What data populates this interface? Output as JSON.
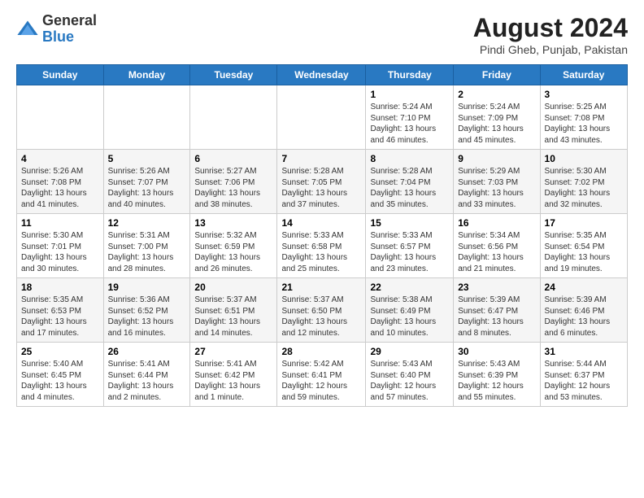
{
  "header": {
    "logo_general": "General",
    "logo_blue": "Blue",
    "month_year": "August 2024",
    "location": "Pindi Gheb, Punjab, Pakistan"
  },
  "weekdays": [
    "Sunday",
    "Monday",
    "Tuesday",
    "Wednesday",
    "Thursday",
    "Friday",
    "Saturday"
  ],
  "weeks": [
    [
      {
        "day": "",
        "info": ""
      },
      {
        "day": "",
        "info": ""
      },
      {
        "day": "",
        "info": ""
      },
      {
        "day": "",
        "info": ""
      },
      {
        "day": "1",
        "info": "Sunrise: 5:24 AM\nSunset: 7:10 PM\nDaylight: 13 hours\nand 46 minutes."
      },
      {
        "day": "2",
        "info": "Sunrise: 5:24 AM\nSunset: 7:09 PM\nDaylight: 13 hours\nand 45 minutes."
      },
      {
        "day": "3",
        "info": "Sunrise: 5:25 AM\nSunset: 7:08 PM\nDaylight: 13 hours\nand 43 minutes."
      }
    ],
    [
      {
        "day": "4",
        "info": "Sunrise: 5:26 AM\nSunset: 7:08 PM\nDaylight: 13 hours\nand 41 minutes."
      },
      {
        "day": "5",
        "info": "Sunrise: 5:26 AM\nSunset: 7:07 PM\nDaylight: 13 hours\nand 40 minutes."
      },
      {
        "day": "6",
        "info": "Sunrise: 5:27 AM\nSunset: 7:06 PM\nDaylight: 13 hours\nand 38 minutes."
      },
      {
        "day": "7",
        "info": "Sunrise: 5:28 AM\nSunset: 7:05 PM\nDaylight: 13 hours\nand 37 minutes."
      },
      {
        "day": "8",
        "info": "Sunrise: 5:28 AM\nSunset: 7:04 PM\nDaylight: 13 hours\nand 35 minutes."
      },
      {
        "day": "9",
        "info": "Sunrise: 5:29 AM\nSunset: 7:03 PM\nDaylight: 13 hours\nand 33 minutes."
      },
      {
        "day": "10",
        "info": "Sunrise: 5:30 AM\nSunset: 7:02 PM\nDaylight: 13 hours\nand 32 minutes."
      }
    ],
    [
      {
        "day": "11",
        "info": "Sunrise: 5:30 AM\nSunset: 7:01 PM\nDaylight: 13 hours\nand 30 minutes."
      },
      {
        "day": "12",
        "info": "Sunrise: 5:31 AM\nSunset: 7:00 PM\nDaylight: 13 hours\nand 28 minutes."
      },
      {
        "day": "13",
        "info": "Sunrise: 5:32 AM\nSunset: 6:59 PM\nDaylight: 13 hours\nand 26 minutes."
      },
      {
        "day": "14",
        "info": "Sunrise: 5:33 AM\nSunset: 6:58 PM\nDaylight: 13 hours\nand 25 minutes."
      },
      {
        "day": "15",
        "info": "Sunrise: 5:33 AM\nSunset: 6:57 PM\nDaylight: 13 hours\nand 23 minutes."
      },
      {
        "day": "16",
        "info": "Sunrise: 5:34 AM\nSunset: 6:56 PM\nDaylight: 13 hours\nand 21 minutes."
      },
      {
        "day": "17",
        "info": "Sunrise: 5:35 AM\nSunset: 6:54 PM\nDaylight: 13 hours\nand 19 minutes."
      }
    ],
    [
      {
        "day": "18",
        "info": "Sunrise: 5:35 AM\nSunset: 6:53 PM\nDaylight: 13 hours\nand 17 minutes."
      },
      {
        "day": "19",
        "info": "Sunrise: 5:36 AM\nSunset: 6:52 PM\nDaylight: 13 hours\nand 16 minutes."
      },
      {
        "day": "20",
        "info": "Sunrise: 5:37 AM\nSunset: 6:51 PM\nDaylight: 13 hours\nand 14 minutes."
      },
      {
        "day": "21",
        "info": "Sunrise: 5:37 AM\nSunset: 6:50 PM\nDaylight: 13 hours\nand 12 minutes."
      },
      {
        "day": "22",
        "info": "Sunrise: 5:38 AM\nSunset: 6:49 PM\nDaylight: 13 hours\nand 10 minutes."
      },
      {
        "day": "23",
        "info": "Sunrise: 5:39 AM\nSunset: 6:47 PM\nDaylight: 13 hours\nand 8 minutes."
      },
      {
        "day": "24",
        "info": "Sunrise: 5:39 AM\nSunset: 6:46 PM\nDaylight: 13 hours\nand 6 minutes."
      }
    ],
    [
      {
        "day": "25",
        "info": "Sunrise: 5:40 AM\nSunset: 6:45 PM\nDaylight: 13 hours\nand 4 minutes."
      },
      {
        "day": "26",
        "info": "Sunrise: 5:41 AM\nSunset: 6:44 PM\nDaylight: 13 hours\nand 2 minutes."
      },
      {
        "day": "27",
        "info": "Sunrise: 5:41 AM\nSunset: 6:42 PM\nDaylight: 13 hours\nand 1 minute."
      },
      {
        "day": "28",
        "info": "Sunrise: 5:42 AM\nSunset: 6:41 PM\nDaylight: 12 hours\nand 59 minutes."
      },
      {
        "day": "29",
        "info": "Sunrise: 5:43 AM\nSunset: 6:40 PM\nDaylight: 12 hours\nand 57 minutes."
      },
      {
        "day": "30",
        "info": "Sunrise: 5:43 AM\nSunset: 6:39 PM\nDaylight: 12 hours\nand 55 minutes."
      },
      {
        "day": "31",
        "info": "Sunrise: 5:44 AM\nSunset: 6:37 PM\nDaylight: 12 hours\nand 53 minutes."
      }
    ]
  ]
}
